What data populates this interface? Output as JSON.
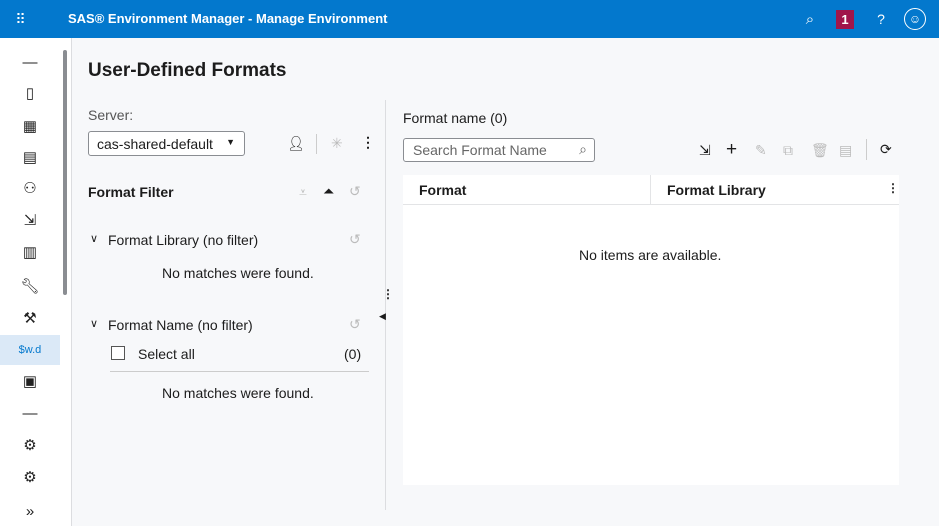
{
  "header": {
    "title": "SAS® Environment Manager - Manage Environment",
    "notification_count": "1",
    "help": "?"
  },
  "sidebar": {
    "selected_label": "$w.d",
    "expand": "»"
  },
  "page": {
    "title": "User-Defined Formats"
  },
  "left": {
    "server_label": "Server:",
    "server_value": "cas-shared-default",
    "filter_title": "Format Filter",
    "library_section": "Format Library (no filter)",
    "library_empty": "No matches were found.",
    "name_section": "Format Name (no filter)",
    "select_all": "Select all",
    "select_count": "(0)",
    "name_empty": "No matches were found."
  },
  "right": {
    "count_label": "Format name (0)",
    "search_placeholder": "Search Format Name",
    "columns": [
      "Format",
      "Format Library"
    ],
    "empty": "No items are available."
  },
  "colors": {
    "header": "#0378cd",
    "badge": "#a0154b",
    "selected": "#dbe9f7"
  }
}
